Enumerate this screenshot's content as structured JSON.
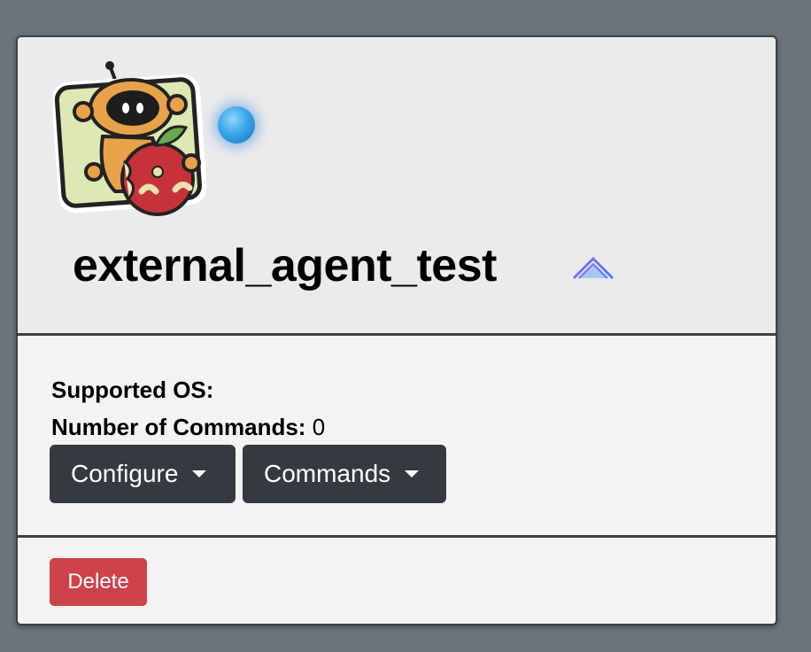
{
  "agent": {
    "name": "external_agent_test",
    "status_color": "#3aa6e8",
    "avatar_icon": "robot-apple-logo"
  },
  "details": {
    "supported_os_label": "Supported OS:",
    "supported_os_value": "",
    "num_commands_label": "Number of Commands:",
    "num_commands_value": "0"
  },
  "buttons": {
    "configure_label": "Configure",
    "commands_label": "Commands",
    "delete_label": "Delete"
  },
  "colors": {
    "dark_button": "#343a40",
    "delete_button": "#d0424a",
    "border": "#3b4147"
  }
}
